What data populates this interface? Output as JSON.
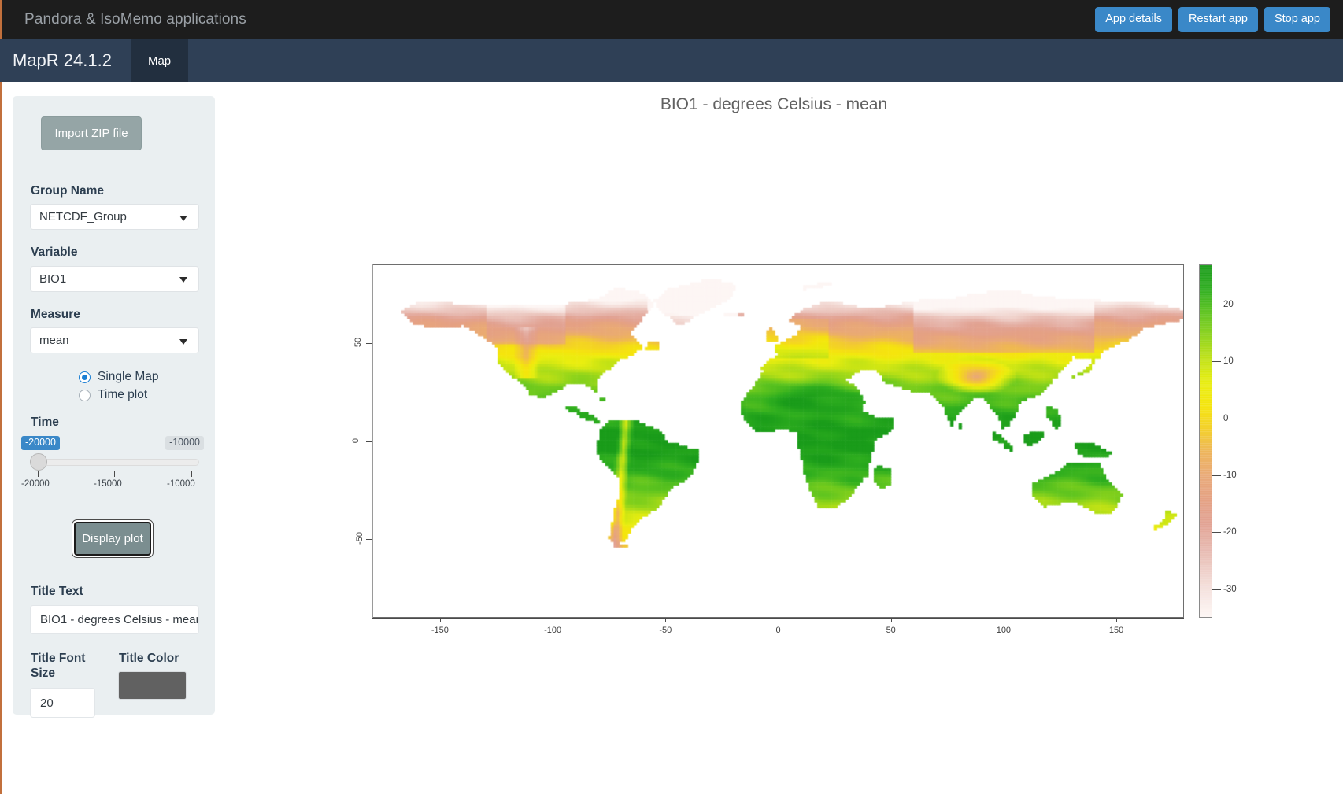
{
  "topbar": {
    "title": "Pandora & IsoMemo applications",
    "buttons": [
      {
        "label": "App details"
      },
      {
        "label": "Restart app"
      },
      {
        "label": "Stop app"
      }
    ]
  },
  "navbar": {
    "brand": "MapR 24.1.2",
    "tabs": [
      {
        "label": "Map",
        "active": true
      }
    ]
  },
  "sidebar": {
    "import_button": "Import ZIP file",
    "group_name": {
      "label": "Group Name",
      "value": "NETCDF_Group"
    },
    "variable": {
      "label": "Variable",
      "value": "BIO1"
    },
    "measure": {
      "label": "Measure",
      "value": "mean"
    },
    "plot_mode": {
      "options": [
        {
          "label": "Single Map",
          "selected": true
        },
        {
          "label": "Time plot",
          "selected": false
        }
      ]
    },
    "time_slider": {
      "label": "Time",
      "value_left": "-20000",
      "value_right": "-10000",
      "min": -20000,
      "max": -10000,
      "ticks": [
        "-20000",
        "-15000",
        "-10000"
      ]
    },
    "display_button": "Display plot",
    "title_text": {
      "label": "Title Text",
      "value": "BIO1 - degrees Celsius - mean"
    },
    "title_font_size": {
      "label": "Title Font Size",
      "value": "20"
    },
    "title_color": {
      "label": "Title Color",
      "value": "#616161"
    }
  },
  "chart_data": {
    "type": "heatmap",
    "title": "BIO1 - degrees Celsius - mean",
    "title_color": "#616161",
    "title_font_size": 20,
    "xlabel": "",
    "ylabel": "",
    "xlim": [
      -180,
      180
    ],
    "ylim": [
      -90,
      90
    ],
    "xticks": [
      -150,
      -100,
      -50,
      0,
      50,
      100,
      150
    ],
    "xtick_labels": [
      "-150",
      "-100",
      "-50",
      "0",
      "50",
      "100",
      "150"
    ],
    "yticks": [
      50,
      0,
      -50
    ],
    "ytick_labels": [
      "50",
      "0",
      "-50"
    ],
    "grid": false,
    "legend": {
      "position": "right",
      "orientation": "vertical",
      "ticks": [
        20,
        10,
        0,
        -10,
        -20,
        -30
      ],
      "tick_labels": [
        "20",
        "10",
        "0",
        "-10",
        "-20",
        "-30"
      ],
      "vmin": -35,
      "vmax": 27,
      "colors": [
        "#1a9c1a",
        "#2fae1f",
        "#5fc41f",
        "#8fd41b",
        "#c2e215",
        "#e9ee10",
        "#f5e50d",
        "#f3cf2a",
        "#eeb45a",
        "#e9a977",
        "#e5a183",
        "#e2a292",
        "#e6b5ab",
        "#eecdc6",
        "#f6e4e0",
        "#fdf6f4"
      ]
    },
    "variable": "BIO1",
    "measure": "mean",
    "units": "degrees Celsius",
    "time": -20000,
    "description": "Global raster of mean annual temperature (BIO1) at 20000 BP; green = warm (~+25C), yellow = ~0C, orange to pale pink = cold (down to ~-35C); oceans are white/blank."
  }
}
